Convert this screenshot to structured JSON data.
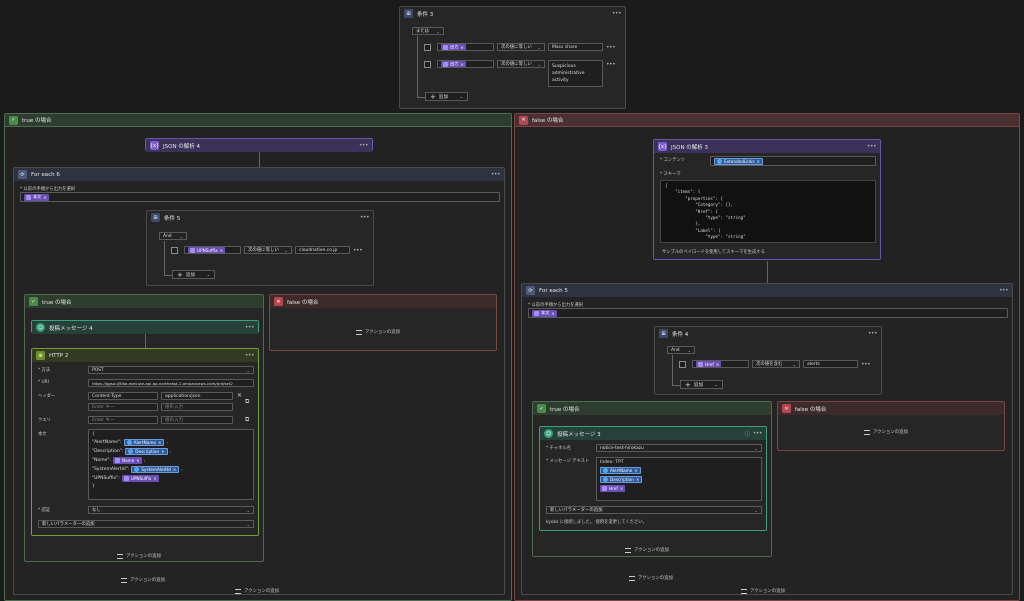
{
  "condition3": {
    "title": "条件 3",
    "operator": "または",
    "row1": {
      "token": "出力",
      "op": "次の値に等しい",
      "value": "Mass share"
    },
    "row2": {
      "token": "出力",
      "op": "次の値に等しい",
      "value_lines": [
        "Suspicious",
        "administrative",
        "activity"
      ]
    },
    "add_label": "追加"
  },
  "true_branch": {
    "title": "true の場合",
    "parse_json4": {
      "title": "JSON の解析 4"
    },
    "foreach6": {
      "title": "For each 6",
      "select_label": "* 以前の手順から出力を選択",
      "token": "本文",
      "condition5": {
        "title": "条件 5",
        "operator": "And",
        "token": "UPNSuffix",
        "op": "次の値に等しい",
        "value": "cloudnative.co.jp",
        "add_label": "追加"
      },
      "inner_true": {
        "title": "true の場合",
        "post_message4": {
          "title": "投稿メッセージ 4"
        },
        "http2": {
          "title": "HTTP 2",
          "method_label": "* 方法",
          "method_value": "POST",
          "uri_label": "* URI",
          "uri_value": "https://ggsuuj5lba.execute-api.ap-northeast-1.amazonaws.com/prd/set2",
          "headers_label": "ヘッダー",
          "header_key": "Content-Type",
          "header_value": "application/json",
          "key_ph": "Enter キー",
          "value_ph": "値の入力",
          "query_label": "クエリ",
          "body_label": "本文",
          "body_open": "{",
          "body_close": "}",
          "body_rows": [
            {
              "key": "\"AlertName\":",
              "token": "AlertName",
              "suffix": ","
            },
            {
              "key": "\"Description\":",
              "token": "Description",
              "suffix": ","
            },
            {
              "key": "\"Name\":",
              "token": "Name",
              "suffix": ","
            },
            {
              "key": "\"SystemAlertId\":",
              "token": "SystemAlertId",
              "suffix": ","
            },
            {
              "key": "\"UPNSuffix\":",
              "token": "UPNSuffix",
              "suffix": ""
            }
          ],
          "auth_label": "* 認証",
          "auth_value": "なし",
          "new_param": "新しいパラメーターの追加"
        },
        "add_action": "アクションの追加"
      },
      "inner_false": {
        "title": "false の場合",
        "add_action": "アクションの追加"
      },
      "add_action": "アクションの追加"
    },
    "add_action": "アクションの追加"
  },
  "false_branch": {
    "title": "false の場合",
    "parse_json3": {
      "title": "JSON の解析 3",
      "content_label": "* コンテンツ",
      "content_token": "ExtendedLinks",
      "schema_label": "* スキーマ",
      "schema_lines": [
        "{",
        "    \"items\": {",
        "        \"properties\": {",
        "            \"Category\": {},",
        "            \"Href\": {",
        "                \"type\": \"string\"",
        "            },",
        "            \"Label\": {",
        "                \"type\": \"string\""
      ],
      "sample_link": "サンプルのペイロードを使用してスキーマを生成する"
    },
    "foreach5": {
      "title": "For each 5",
      "select_label": "* 以前の手順から出力を選択",
      "token": "本文",
      "condition4": {
        "title": "条件 4",
        "operator": "And",
        "token": "Href",
        "op": "次の値を含む",
        "value": "alerts",
        "add_label": "追加"
      },
      "inner_true": {
        "title": "true の場合",
        "post_message3": {
          "title": "投稿メッセージ 3",
          "channel_label": "* チャネル名",
          "channel_value": "notice-test-hirokazu",
          "message_label": "* メッセージ テキスト",
          "message_prefix": "Index: TPT",
          "tokens": [
            "AlertName",
            "Description",
            "Href"
          ],
          "new_param": "新しいパラメーターの追加",
          "footer": "kyoko に接続しました。  接続を変更してください。"
        },
        "add_action": "アクションの追加"
      },
      "inner_false": {
        "title": "false の場合",
        "add_action": "アクションの追加"
      },
      "add_action": "アクションの追加"
    },
    "add_action": "アクションの追加"
  }
}
